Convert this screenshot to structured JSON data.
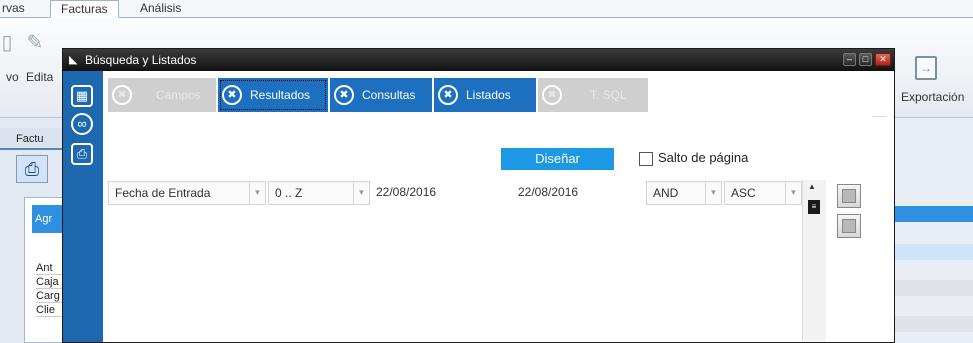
{
  "app": {
    "tabs": [
      "rvas",
      "Facturas",
      "Análisis"
    ],
    "ribbon_labels": {
      "left": "vo",
      "edit": "Edita",
      "export": "Exportación"
    },
    "side_header": "Factu",
    "side_blue_label": "Agr",
    "side_rows": [
      "Ant",
      "Caja",
      "Carg",
      "Clie"
    ]
  },
  "dialog": {
    "title": "Búsqueda y Listados",
    "window_buttons": {
      "minimize": "–",
      "maximize": "□",
      "close": "✕"
    },
    "tabs": [
      {
        "label": "Campos",
        "state": "disabled"
      },
      {
        "label": "Resultados",
        "state": "selected"
      },
      {
        "label": "Consultas",
        "state": "enabled"
      },
      {
        "label": "Listados",
        "state": "enabled"
      },
      {
        "label": "T. SQL",
        "state": "disabled"
      }
    ],
    "tab_close_glyph": "✖",
    "design_button": "Diseñar",
    "page_break_label": "Salto de página",
    "page_break_checked": false,
    "condition": {
      "field": "Fecha de Entrada",
      "range": "0 .. Z",
      "value_from": "22/08/2016",
      "value_to": "22/08/2016",
      "logic": "AND",
      "order": "ASC"
    }
  },
  "colors": {
    "dialog_accent": "#1d6fc0",
    "design_button": "#1d98e5",
    "side_bar": "#1e68b0"
  }
}
